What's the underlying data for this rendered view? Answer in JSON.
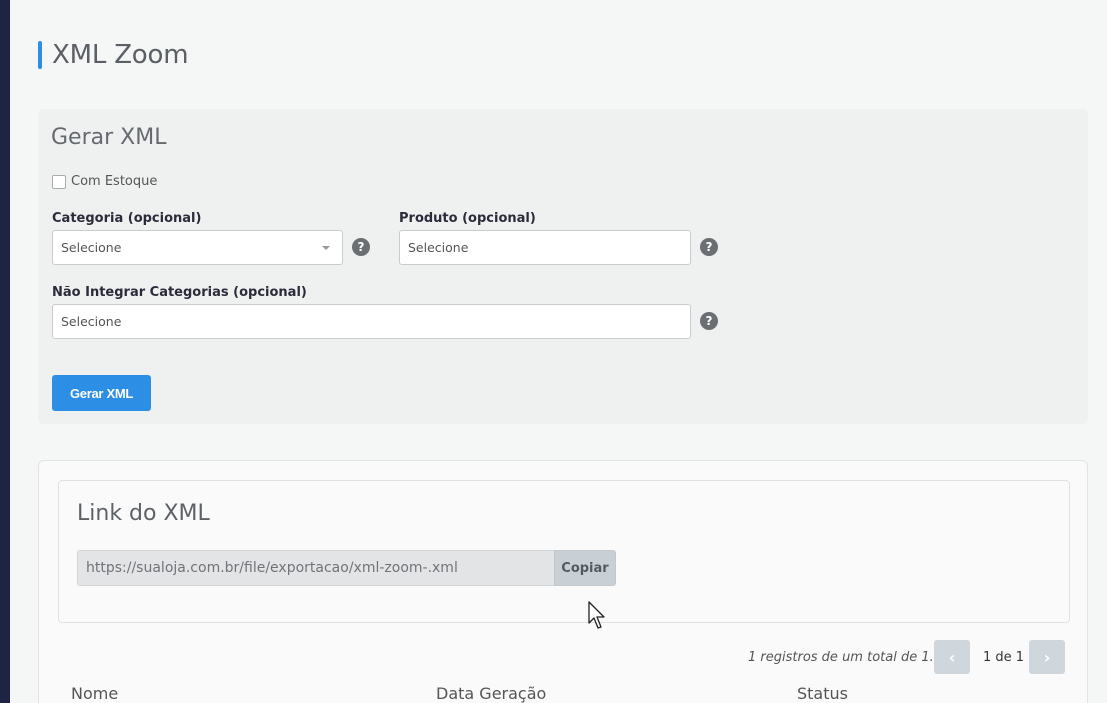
{
  "page": {
    "title": "XML Zoom"
  },
  "gerar": {
    "heading": "Gerar XML",
    "checkbox_label": "Com Estoque",
    "categoria": {
      "label": "Categoria (opcional)",
      "value": "Selecione"
    },
    "produto": {
      "label": "Produto (opcional)",
      "placeholder": "Selecione"
    },
    "nao_integrar": {
      "label": "Não Integrar Categorias (opcional)",
      "placeholder": "Selecione"
    },
    "help": "?",
    "button_label": "Gerar XML"
  },
  "link": {
    "heading": "Link do XML",
    "url": "https://sualoja.com.br/file/exportacao/xml-zoom-.xml",
    "copy_label": "Copiar"
  },
  "pagination": {
    "records_text": "1 registros de um total de 1.",
    "prev": "‹",
    "page_text": "1 de 1",
    "next": "›"
  },
  "table": {
    "columns": [
      "Nome",
      "Data Geração",
      "Status"
    ]
  },
  "colors": {
    "accent": "#2d8ee6",
    "sidebar": "#1f2344"
  }
}
